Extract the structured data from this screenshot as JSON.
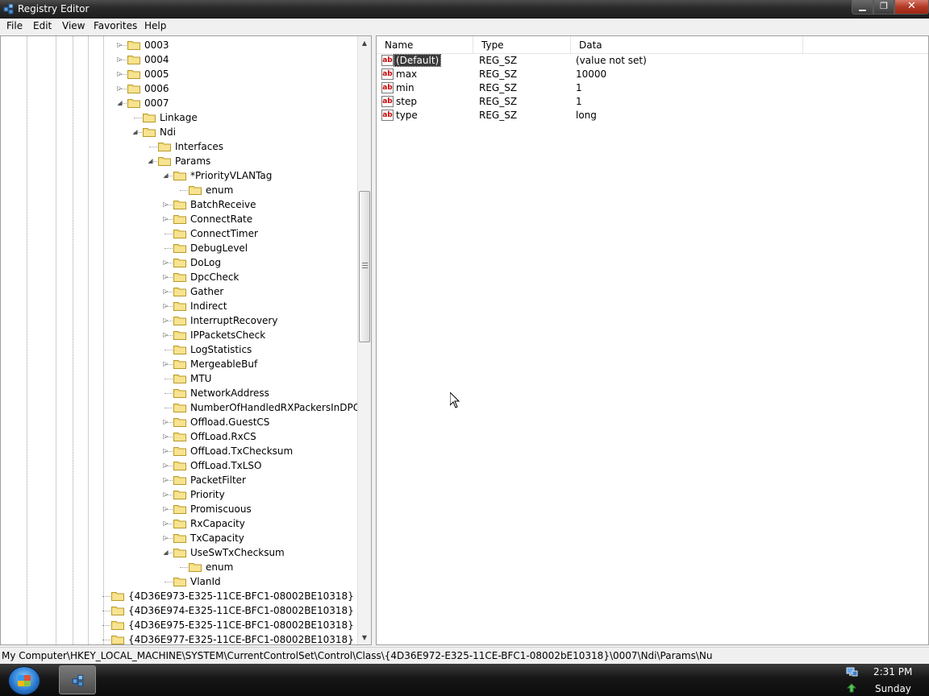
{
  "window": {
    "title": "Registry Editor"
  },
  "menu": [
    "File",
    "Edit",
    "View",
    "Favorites",
    "Help"
  ],
  "tree": [
    {
      "label": "0003",
      "level": 0,
      "expander": "collapsed"
    },
    {
      "label": "0004",
      "level": 0,
      "expander": "collapsed"
    },
    {
      "label": "0005",
      "level": 0,
      "expander": "collapsed"
    },
    {
      "label": "0006",
      "level": 0,
      "expander": "collapsed"
    },
    {
      "label": "0007",
      "level": 0,
      "expander": "expanded"
    },
    {
      "label": "Linkage",
      "level": 1,
      "expander": "none"
    },
    {
      "label": "Ndi",
      "level": 1,
      "expander": "expanded"
    },
    {
      "label": "Interfaces",
      "level": 2,
      "expander": "none"
    },
    {
      "label": "Params",
      "level": 2,
      "expander": "expanded"
    },
    {
      "label": "*PriorityVLANTag",
      "level": 3,
      "expander": "expanded"
    },
    {
      "label": "enum",
      "level": 4,
      "expander": "none"
    },
    {
      "label": "BatchReceive",
      "level": 3,
      "expander": "collapsed"
    },
    {
      "label": "ConnectRate",
      "level": 3,
      "expander": "collapsed"
    },
    {
      "label": "ConnectTimer",
      "level": 3,
      "expander": "none"
    },
    {
      "label": "DebugLevel",
      "level": 3,
      "expander": "none"
    },
    {
      "label": "DoLog",
      "level": 3,
      "expander": "collapsed"
    },
    {
      "label": "DpcCheck",
      "level": 3,
      "expander": "collapsed"
    },
    {
      "label": "Gather",
      "level": 3,
      "expander": "collapsed"
    },
    {
      "label": "Indirect",
      "level": 3,
      "expander": "collapsed"
    },
    {
      "label": "InterruptRecovery",
      "level": 3,
      "expander": "collapsed"
    },
    {
      "label": "IPPacketsCheck",
      "level": 3,
      "expander": "collapsed"
    },
    {
      "label": "LogStatistics",
      "level": 3,
      "expander": "none"
    },
    {
      "label": "MergeableBuf",
      "level": 3,
      "expander": "collapsed"
    },
    {
      "label": "MTU",
      "level": 3,
      "expander": "none"
    },
    {
      "label": "NetworkAddress",
      "level": 3,
      "expander": "none"
    },
    {
      "label": "NumberOfHandledRXPackersInDPC",
      "level": 3,
      "expander": "none"
    },
    {
      "label": "Offload.GuestCS",
      "level": 3,
      "expander": "collapsed"
    },
    {
      "label": "OffLoad.RxCS",
      "level": 3,
      "expander": "collapsed"
    },
    {
      "label": "OffLoad.TxChecksum",
      "level": 3,
      "expander": "collapsed"
    },
    {
      "label": "OffLoad.TxLSO",
      "level": 3,
      "expander": "collapsed"
    },
    {
      "label": "PacketFilter",
      "level": 3,
      "expander": "collapsed"
    },
    {
      "label": "Priority",
      "level": 3,
      "expander": "collapsed"
    },
    {
      "label": "Promiscuous",
      "level": 3,
      "expander": "collapsed"
    },
    {
      "label": "RxCapacity",
      "level": 3,
      "expander": "collapsed"
    },
    {
      "label": "TxCapacity",
      "level": 3,
      "expander": "collapsed"
    },
    {
      "label": "UseSwTxChecksum",
      "level": 3,
      "expander": "expanded"
    },
    {
      "label": "enum",
      "level": 4,
      "expander": "none"
    },
    {
      "label": "VlanId",
      "level": 3,
      "expander": "none"
    },
    {
      "label": "{4D36E973-E325-11CE-BFC1-08002BE10318}",
      "level": -1,
      "expander": "none"
    },
    {
      "label": "{4D36E974-E325-11CE-BFC1-08002BE10318}",
      "level": -1,
      "expander": "none"
    },
    {
      "label": "{4D36E975-E325-11CE-BFC1-08002BE10318}",
      "level": -1,
      "expander": "none"
    },
    {
      "label": "{4D36E977-E325-11CE-BFC1-08002BE10318}",
      "level": -1,
      "expander": "none"
    }
  ],
  "list": {
    "columns": [
      "Name",
      "Type",
      "Data"
    ],
    "rows": [
      {
        "name": "(Default)",
        "type": "REG_SZ",
        "data": "(value not set)",
        "selected": true
      },
      {
        "name": "max",
        "type": "REG_SZ",
        "data": "10000",
        "selected": false
      },
      {
        "name": "min",
        "type": "REG_SZ",
        "data": "1",
        "selected": false
      },
      {
        "name": "step",
        "type": "REG_SZ",
        "data": "1",
        "selected": false
      },
      {
        "name": "type",
        "type": "REG_SZ",
        "data": "long",
        "selected": false
      }
    ],
    "value_icon_text": "ab"
  },
  "status": {
    "path": "My Computer\\HKEY_LOCAL_MACHINE\\SYSTEM\\CurrentControlSet\\Control\\Class\\{4D36E972-E325-11CE-BFC1-08002bE10318}\\0007\\Ndi\\Params\\Nu"
  },
  "taskbar": {
    "time": "2:31 PM",
    "day": "Sunday"
  },
  "icons": {
    "folder": "folder-icon",
    "value": "string-value-icon",
    "start": "windows-start-icon",
    "app": "registry-editor-icon"
  }
}
